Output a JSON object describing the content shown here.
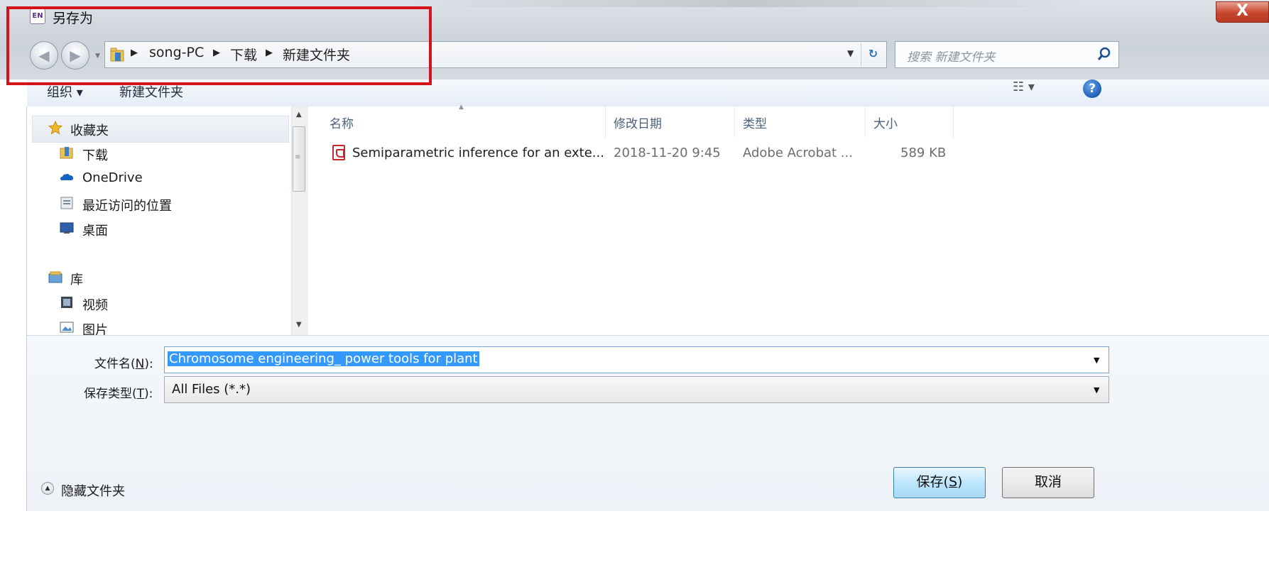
{
  "window": {
    "title": "另存为",
    "app_icon_text": "EN",
    "close_glyph": "X"
  },
  "address": {
    "crumbs": [
      "song-PC",
      "下载",
      "新建文件夹"
    ],
    "search_placeholder": "搜索 新建文件夹"
  },
  "toolbar": {
    "organize": "组织 ▾",
    "new_folder": "新建文件夹",
    "view_glyph": "☷ ▾",
    "help": "?"
  },
  "nav": {
    "favorites": "收藏夹",
    "items": [
      "下载",
      "OneDrive",
      "最近访问的位置",
      "桌面"
    ],
    "library": "库",
    "library_items": [
      "视频",
      "图片"
    ]
  },
  "filelist": {
    "columns": [
      "名称",
      "修改日期",
      "类型",
      "大小"
    ],
    "rows": [
      {
        "name": "Semiparametric inference for an exte...",
        "date": "2018-11-20 9:45",
        "type": "Adobe Acrobat ...",
        "size": "589 KB"
      }
    ]
  },
  "form": {
    "filename_label_pre": "文件名(",
    "filename_label_key": "N",
    "filename_label_post": "):",
    "filename_value": "Chromosome engineering_ power tools for plant",
    "type_label_pre": "保存类型(",
    "type_label_key": "T",
    "type_label_post": "):",
    "type_value": "All Files (*.*)"
  },
  "footer": {
    "hide_folders": "隐藏文件夹",
    "save_pre": "保存(",
    "save_key": "S",
    "save_post": ")",
    "cancel": "取消"
  },
  "colors": {
    "accent": "#3399ff",
    "highlight_box": "#d4141a",
    "close_red": "#c8452e"
  }
}
